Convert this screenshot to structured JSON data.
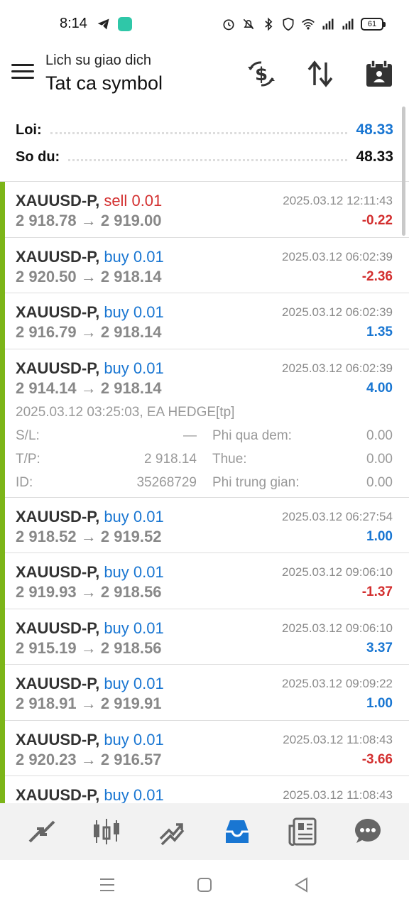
{
  "status_bar": {
    "time": "8:14",
    "battery": "61",
    "icons": [
      "telegram-icon",
      "app-badge-icon",
      "alarm-icon",
      "mute-icon",
      "bluetooth-icon",
      "vpn-shield-icon",
      "wifi-icon",
      "signal-icon",
      "signal-icon",
      "battery-icon"
    ]
  },
  "header": {
    "subtitle": "Lich su giao dich",
    "title": "Tat ca symbol",
    "icons": [
      "currency-exchange-icon",
      "sort-icon",
      "calendar-icon"
    ]
  },
  "summary": {
    "profit_label": "Loi:",
    "profit_value": "48.33",
    "balance_label": "So du:",
    "balance_value": "48.33"
  },
  "trades": [
    {
      "symbol": "XAUUSD-P,",
      "side": "sell",
      "volume": "0.01",
      "time": "2025.03.12 12:11:43",
      "prices": "2 918.78 → 2 919.00",
      "pl": "-0.22",
      "pl_color": "#d32f2f"
    },
    {
      "symbol": "XAUUSD-P,",
      "side": "buy",
      "volume": "0.01",
      "time": "2025.03.12 06:02:39",
      "prices": "2 920.50 → 2 918.14",
      "pl": "-2.36",
      "pl_color": "#d32f2f"
    },
    {
      "symbol": "XAUUSD-P,",
      "side": "buy",
      "volume": "0.01",
      "time": "2025.03.12 06:02:39",
      "prices": "2 916.79 → 2 918.14",
      "pl": "1.35",
      "pl_color": "#1976d2"
    },
    {
      "symbol": "XAUUSD-P,",
      "side": "buy",
      "volume": "0.01",
      "time": "2025.03.12 06:02:39",
      "prices": "2 914.14 → 2 918.14",
      "pl": "4.00",
      "pl_color": "#1976d2",
      "details": {
        "comment": "2025.03.12 03:25:03, EA HEDGE[tp]",
        "sl_label": "S/L:",
        "sl_value": "—",
        "tp_label": "T/P:",
        "tp_value": "2 918.14",
        "id_label": "ID:",
        "id_value": "35268729",
        "swap_label": "Phi qua dem:",
        "swap_value": "0.00",
        "tax_label": "Thue:",
        "tax_value": "0.00",
        "commission_label": "Phi trung gian:",
        "commission_value": "0.00"
      }
    },
    {
      "symbol": "XAUUSD-P,",
      "side": "buy",
      "volume": "0.01",
      "time": "2025.03.12 06:27:54",
      "prices": "2 918.52 → 2 919.52",
      "pl": "1.00",
      "pl_color": "#1976d2"
    },
    {
      "symbol": "XAUUSD-P,",
      "side": "buy",
      "volume": "0.01",
      "time": "2025.03.12 09:06:10",
      "prices": "2 919.93 → 2 918.56",
      "pl": "-1.37",
      "pl_color": "#d32f2f"
    },
    {
      "symbol": "XAUUSD-P,",
      "side": "buy",
      "volume": "0.01",
      "time": "2025.03.12 09:06:10",
      "prices": "2 915.19 → 2 918.56",
      "pl": "3.37",
      "pl_color": "#1976d2"
    },
    {
      "symbol": "XAUUSD-P,",
      "side": "buy",
      "volume": "0.01",
      "time": "2025.03.12 09:09:22",
      "prices": "2 918.91 → 2 919.91",
      "pl": "1.00",
      "pl_color": "#1976d2"
    },
    {
      "symbol": "XAUUSD-P,",
      "side": "buy",
      "volume": "0.01",
      "time": "2025.03.12 11:08:43",
      "prices": "2 920.23 → 2 916.57",
      "pl": "-3.66",
      "pl_color": "#d32f2f"
    },
    {
      "symbol": "XAUUSD-P,",
      "side": "buy",
      "volume": "0.01",
      "time": "2025.03.12 11:08:43",
      "prices": "",
      "pl": "",
      "pl_color": "#1976d2"
    }
  ],
  "bottom_nav": [
    "quotes-icon",
    "chart-icon",
    "trade-icon",
    "history-icon",
    "news-icon",
    "messages-icon"
  ],
  "bottom_nav_active": "history-icon",
  "colors": {
    "accent": "#1976d2",
    "loss": "#d32f2f",
    "trade_bar": "#7cb518"
  }
}
